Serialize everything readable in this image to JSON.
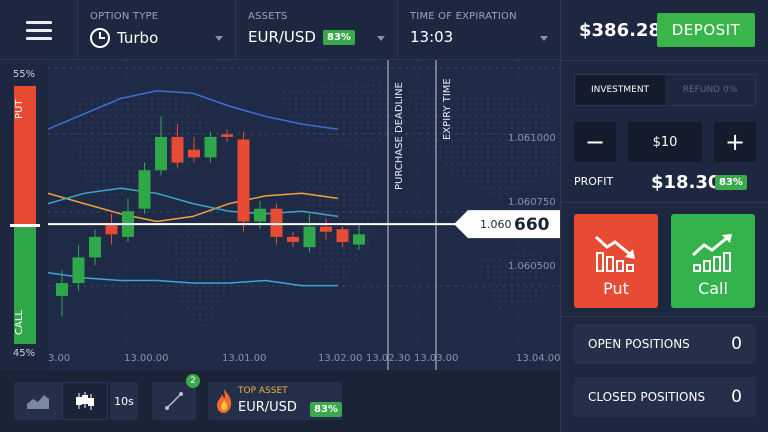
{
  "menu": {
    "icon": "hamburger-menu-icon"
  },
  "header": {
    "option_type": {
      "label": "OPTION TYPE",
      "value": "Turbo",
      "icon": "clock-icon"
    },
    "assets": {
      "label": "ASSETS",
      "value": "EUR/USD",
      "payout": "83%"
    },
    "expiration": {
      "label": "TIME OF EXPIRATION",
      "value": "13:03"
    }
  },
  "payout_bar": {
    "top_pct": "55%",
    "bottom_pct": "45%",
    "put_label": "PUT",
    "call_label": "CALL",
    "put_share": 0.55,
    "colors": {
      "put": "#e74b33",
      "call": "#2fa84a"
    }
  },
  "chart": {
    "deadline_label": "PURCHASE DEADLINE",
    "expiry_label": "EXPIRY TIME",
    "current_price_small": "1.060",
    "current_price_big": "660",
    "y_ticks": [
      "1.061000",
      "1.060750",
      "1.060500"
    ],
    "x_ticks": [
      "3.00",
      "13.00.00",
      "13.01.00",
      "13.02.00",
      "13.02.30",
      "13.03.00",
      "13.04.00"
    ]
  },
  "chart_data": {
    "type": "candlestick",
    "candles": [
      {
        "o": 1.06038,
        "h": 1.06048,
        "l": 1.0603,
        "c": 1.06043
      },
      {
        "o": 1.06043,
        "h": 1.06058,
        "l": 1.0604,
        "c": 1.06053
      },
      {
        "o": 1.06053,
        "h": 1.06064,
        "l": 1.0605,
        "c": 1.06061
      },
      {
        "o": 1.06066,
        "h": 1.0607,
        "l": 1.06058,
        "c": 1.06062
      },
      {
        "o": 1.06061,
        "h": 1.06076,
        "l": 1.06059,
        "c": 1.06071
      },
      {
        "o": 1.06072,
        "h": 1.0609,
        "l": 1.0607,
        "c": 1.06087
      },
      {
        "o": 1.06087,
        "h": 1.06108,
        "l": 1.06085,
        "c": 1.061
      },
      {
        "o": 1.061,
        "h": 1.06105,
        "l": 1.06088,
        "c": 1.0609
      },
      {
        "o": 1.06095,
        "h": 1.061,
        "l": 1.0609,
        "c": 1.06092
      },
      {
        "o": 1.06092,
        "h": 1.06102,
        "l": 1.0609,
        "c": 1.061
      },
      {
        "o": 1.06101,
        "h": 1.06103,
        "l": 1.06098,
        "c": 1.061
      },
      {
        "o": 1.06099,
        "h": 1.06102,
        "l": 1.06063,
        "c": 1.06067
      },
      {
        "o": 1.06067,
        "h": 1.06075,
        "l": 1.06064,
        "c": 1.06072
      },
      {
        "o": 1.06072,
        "h": 1.06074,
        "l": 1.06058,
        "c": 1.06061
      },
      {
        "o": 1.06061,
        "h": 1.06063,
        "l": 1.06057,
        "c": 1.06059
      },
      {
        "o": 1.06057,
        "h": 1.0607,
        "l": 1.06055,
        "c": 1.06065
      },
      {
        "o": 1.06065,
        "h": 1.06068,
        "l": 1.0606,
        "c": 1.06063
      },
      {
        "o": 1.06064,
        "h": 1.06065,
        "l": 1.06057,
        "c": 1.06059
      },
      {
        "o": 1.06058,
        "h": 1.06066,
        "l": 1.06056,
        "c": 1.06062
      }
    ],
    "indicator_lines": [
      {
        "color": "#3c6fd1",
        "values": [
          1.06103,
          1.06109,
          1.06115,
          1.06118,
          1.06117,
          1.06112,
          1.06108,
          1.06105,
          1.06103
        ]
      },
      {
        "color": "#f0a23c",
        "values": [
          1.06078,
          1.06074,
          1.0607,
          1.06067,
          1.06069,
          1.06074,
          1.06077,
          1.06078,
          1.06076
        ]
      },
      {
        "color": "#3fa6c9",
        "values": [
          1.06074,
          1.06078,
          1.0608,
          1.06078,
          1.06074,
          1.06071,
          1.0607,
          1.06071,
          1.06069
        ]
      },
      {
        "color": "#3aa6d9",
        "values": [
          1.06047,
          1.06045,
          1.06044,
          1.06044,
          1.06043,
          1.06043,
          1.06044,
          1.06042,
          1.06042
        ]
      }
    ],
    "current_price": 1.06066,
    "ylim": [
      1.0602,
      1.0613
    ]
  },
  "toolbar": {
    "chart_type_icon": "area-chart-icon",
    "candles_icon": "candlestick-icon",
    "interval": "10s",
    "drawing_icon": "trendline-icon",
    "drawing_count": "2",
    "top_asset_label": "TOP ASSET",
    "top_asset_symbol": "EUR/USD",
    "top_asset_payout": "83%"
  },
  "right_panel": {
    "balance": "$386.28",
    "deposit_label": "DEPOSIT",
    "tab_investment": "INVESTMENT",
    "tab_refund": "REFUND 0%",
    "minus": "−",
    "plus": "+",
    "amount": "$10",
    "profit_label": "PROFIT",
    "profit_value": "$18.30",
    "profit_pct": "83%",
    "put_label": "Put",
    "call_label": "Call",
    "open_positions_label": "OPEN POSITIONS",
    "open_positions_count": "0",
    "closed_positions_label": "CLOSED POSITIONS",
    "closed_positions_count": "0"
  }
}
